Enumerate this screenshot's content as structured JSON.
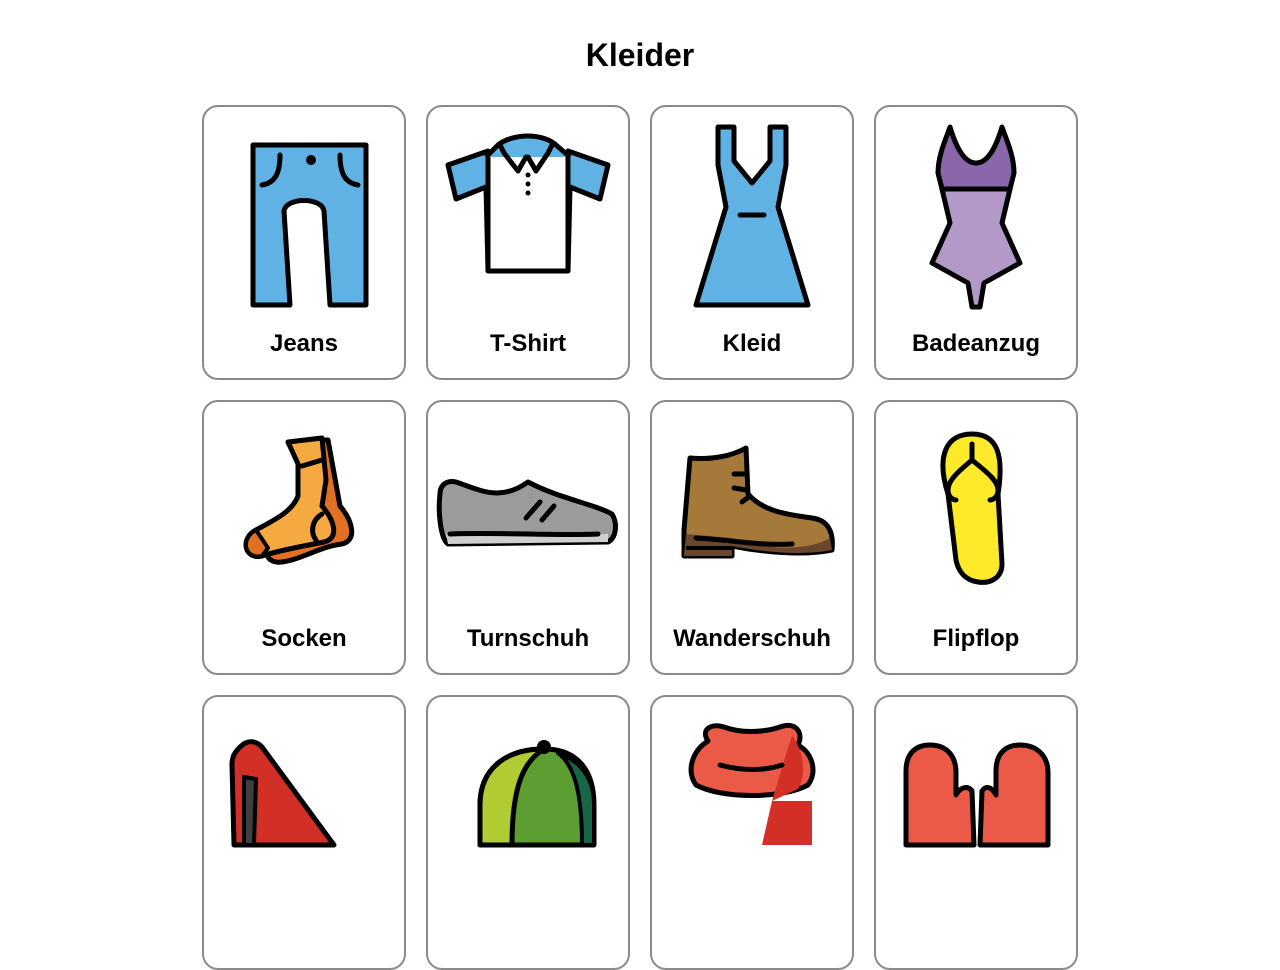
{
  "page": {
    "title": "Kleider"
  },
  "items": [
    {
      "label": "Jeans",
      "icon": "jeans-icon"
    },
    {
      "label": "T-Shirt",
      "icon": "tshirt-icon"
    },
    {
      "label": "Kleid",
      "icon": "dress-icon"
    },
    {
      "label": "Badeanzug",
      "icon": "swimsuit-icon"
    },
    {
      "label": "Socken",
      "icon": "socks-icon"
    },
    {
      "label": "Turnschuh",
      "icon": "sneaker-icon"
    },
    {
      "label": "Wanderschuh",
      "icon": "hiking-boot-icon"
    },
    {
      "label": "Flipflop",
      "icon": "flipflop-icon"
    },
    {
      "label": "",
      "icon": "high-heel-icon"
    },
    {
      "label": "",
      "icon": "cap-icon"
    },
    {
      "label": "",
      "icon": "scarf-icon"
    },
    {
      "label": "",
      "icon": "mittens-icon"
    }
  ],
  "colors": {
    "blue": "#61b2e4",
    "purple_light": "#b399c8",
    "purple_dark": "#8967aa",
    "orange": "#f4aa41",
    "orange_dark": "#e27022",
    "gray": "#9b9b9a",
    "brown": "#a57939",
    "yellow": "#fcea2b",
    "red": "#ea5a47",
    "green": "#5c9e31"
  }
}
